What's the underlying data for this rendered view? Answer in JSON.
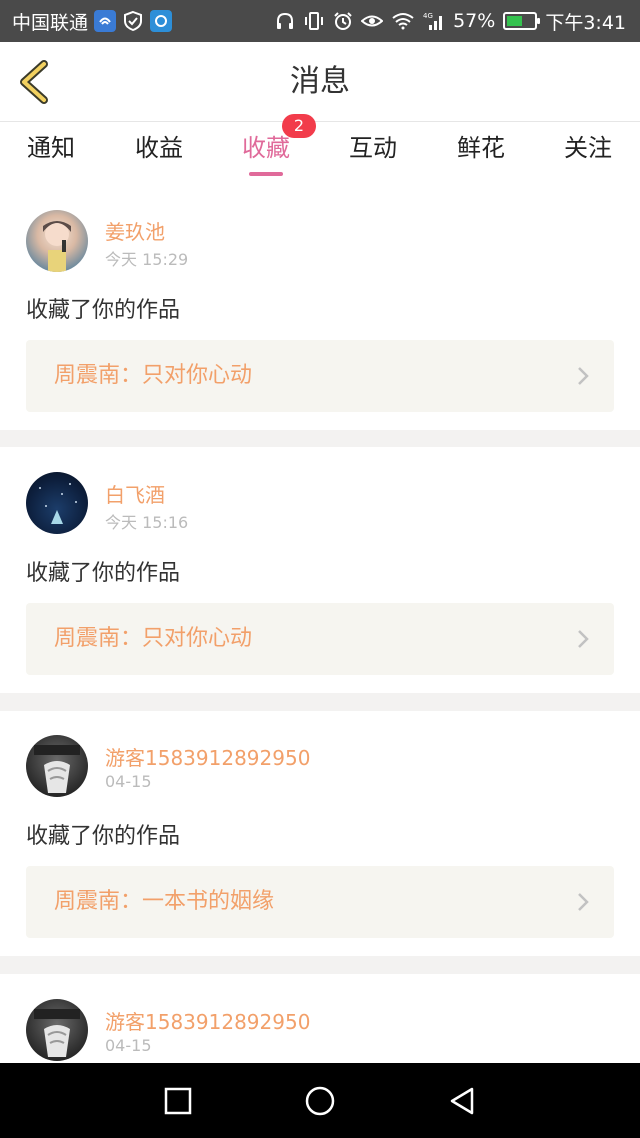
{
  "status_bar": {
    "carrier": "中国联通",
    "battery": "57%",
    "battery_level": 0.57,
    "time": "下午3:41",
    "network": "4G"
  },
  "header": {
    "title": "消息",
    "back_icon": "chevron-left-icon"
  },
  "tabs": [
    {
      "label": "通知"
    },
    {
      "label": "收益"
    },
    {
      "label": "收藏",
      "badge": "2",
      "active": true
    },
    {
      "label": "互动"
    },
    {
      "label": "鲜花"
    },
    {
      "label": "关注"
    }
  ],
  "items": [
    {
      "user": "姜玖池",
      "time": "今天 15:29",
      "action": "收藏了你的作品",
      "work": "周震南：只对你心动"
    },
    {
      "user": "白飞酒",
      "time": "今天 15:16",
      "action": "收藏了你的作品",
      "work": "周震南：只对你心动"
    },
    {
      "user": "游客1583912892950",
      "time": "04-15",
      "action": "收藏了你的作品",
      "work": "周震南：一本书的姻缘"
    },
    {
      "user": "游客1583912892950",
      "time": "04-15"
    }
  ],
  "nav": {
    "recent_icon": "square-icon",
    "home_icon": "circle-icon",
    "back_icon": "triangle-back-icon"
  },
  "colors": {
    "accent": "#e06a9a",
    "username": "#f2a06a",
    "badge": "#f23c4b"
  }
}
